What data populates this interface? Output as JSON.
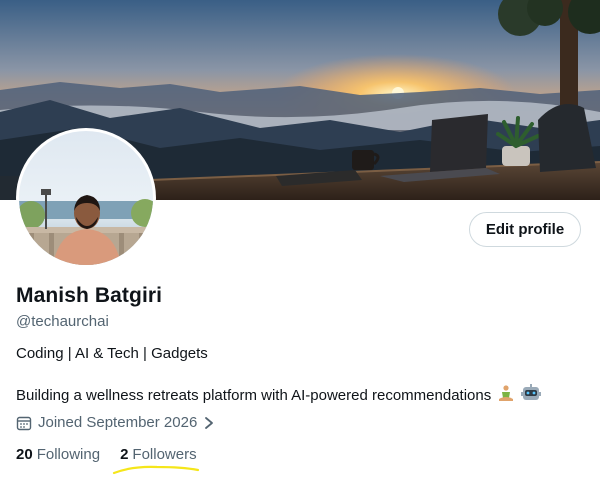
{
  "profile": {
    "name": "Manish Batgiri",
    "handle": "@techaurchai",
    "bio_line1": "Coding | AI & Tech | Gadgets",
    "bio_line2": "Building a wellness retreats platform with AI-powered recommendations",
    "emojis": [
      "person-in-lotus-position",
      "robot"
    ],
    "joined": "Joined September 2026",
    "following_count": "20",
    "following_label": "Following",
    "followers_count": "2",
    "followers_label": "Followers"
  },
  "actions": {
    "edit_profile": "Edit profile"
  },
  "colors": {
    "text_primary": "#0f1419",
    "text_secondary": "#536471",
    "button_border": "#cfd9de",
    "highlight_underline": "#f5e61a"
  },
  "icons": {
    "joined": "calendar-icon",
    "joined_arrow": "chevron-right-icon"
  }
}
